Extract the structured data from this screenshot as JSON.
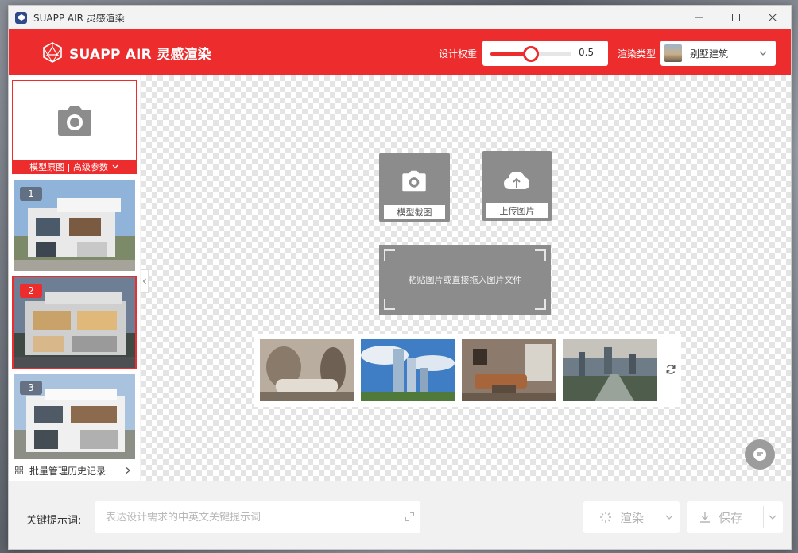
{
  "window": {
    "title": "SUAPP AIR 灵感渲染"
  },
  "header": {
    "logo_text": "SUAPP AIR 灵感渲染",
    "weight_label": "设计权重",
    "weight_value": "0.5",
    "weight_fraction": 0.5,
    "render_type_label": "渲染类型",
    "render_type_value": "别墅建筑"
  },
  "sidebar": {
    "model_card_label": "模型原图 | 高级参数",
    "history": [
      {
        "index": "1",
        "selected": false
      },
      {
        "index": "2",
        "selected": true
      },
      {
        "index": "3",
        "selected": false
      }
    ],
    "footer_label": "批量管理历史记录"
  },
  "canvas": {
    "screenshot_label": "模型截图",
    "upload_label": "上传图片",
    "dropzone_text": "粘贴图片或直接拖入图片文件"
  },
  "bottom": {
    "keywords_label": "关键提示词:",
    "keywords_placeholder": "表达设计需求的中英文关键提示词",
    "keywords_value": "",
    "render_label": "渲染",
    "save_label": "保存"
  },
  "colors": {
    "accent": "#ed2d2d",
    "tile_gray": "#8c8c8c"
  }
}
